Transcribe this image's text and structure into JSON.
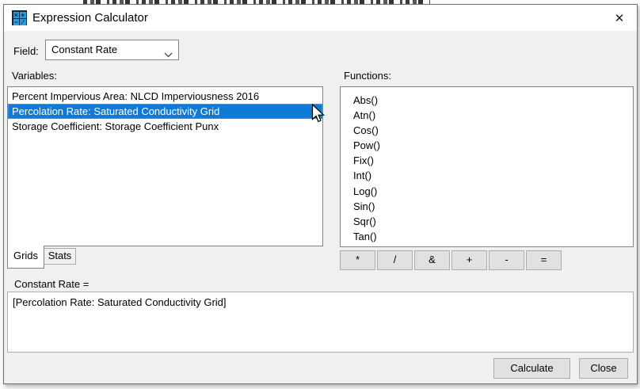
{
  "window": {
    "title": "Expression Calculator",
    "close_glyph": "✕",
    "icon_tiles": [
      "×",
      "+",
      "−",
      "∕"
    ]
  },
  "field": {
    "label": "Field:",
    "value": "Constant Rate"
  },
  "variables": {
    "label": "Variables:",
    "items": [
      {
        "text": "Percent Impervious Area: NLCD Imperviousness 2016",
        "selected": false
      },
      {
        "text": "Percolation Rate: Saturated Conductivity Grid",
        "selected": true
      },
      {
        "text": "Storage Coefficient: Storage Coefficient Punx",
        "selected": false
      }
    ],
    "tabs": [
      {
        "label": "Grids",
        "active": true
      },
      {
        "label": "Stats",
        "active": false
      }
    ]
  },
  "functions": {
    "label": "Functions:",
    "items": [
      "Abs()",
      "Atn()",
      "Cos()",
      "Pow()",
      "Fix()",
      "Int()",
      "Log()",
      "Sin()",
      "Sqr()",
      "Tan()"
    ]
  },
  "operator_buttons": [
    "*",
    "/",
    "&",
    "+",
    "-",
    "="
  ],
  "expression": {
    "label": "Constant Rate =",
    "value": "[Percolation Rate: Saturated Conductivity Grid]"
  },
  "actions": {
    "calculate_label": "Calculate",
    "close_label": "Close"
  },
  "colors": {
    "selection_bg": "#0f7bd7",
    "selection_focus_border": "#e08a00",
    "dialog_bg": "#f0f0f0",
    "titlebar_bg": "#ffffff",
    "control_border": "#848484",
    "button_bg": "#e1e1e1",
    "button_border": "#adadad"
  }
}
